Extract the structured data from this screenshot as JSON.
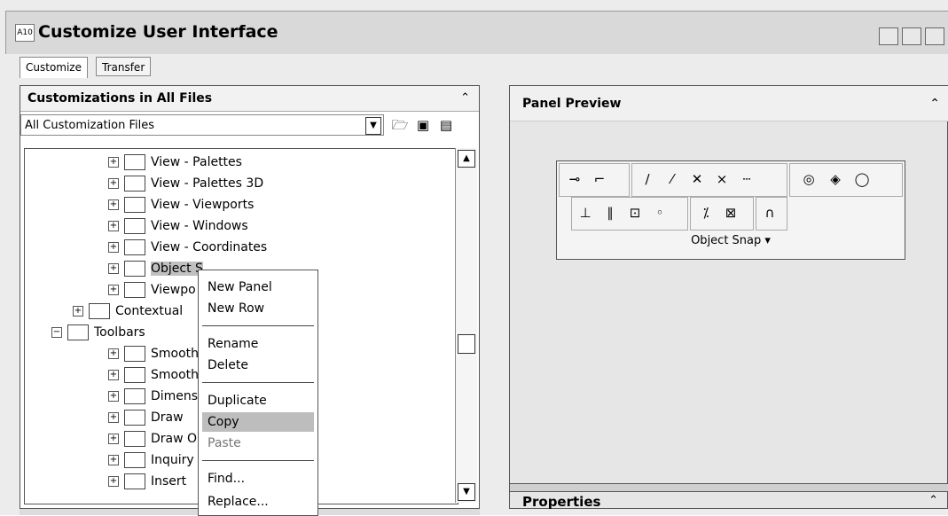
{
  "window": {
    "title": "Customize User Interface",
    "app_icon": "A10"
  },
  "tabs": [
    {
      "label": "Customize"
    },
    {
      "label": "Transfer"
    }
  ],
  "left_panel": {
    "header": "Customizations in All Files",
    "collapse_glyph": "⌃",
    "dropdown_value": "All Customization Files",
    "tree": [
      {
        "label": "View - Palettes"
      },
      {
        "label": "View - Palettes 3D"
      },
      {
        "label": "View - Viewports"
      },
      {
        "label": "View - Windows"
      },
      {
        "label": "View - Coordinates"
      },
      {
        "label": "Object S"
      },
      {
        "label": "Viewpo"
      },
      {
        "label": "Contextual"
      },
      {
        "label": "Toolbars"
      },
      {
        "label": "Smooth Me"
      },
      {
        "label": "Smooth Me"
      },
      {
        "label": "Dimension"
      },
      {
        "label": "Draw"
      },
      {
        "label": "Draw Orde"
      },
      {
        "label": "Inquiry"
      },
      {
        "label": "Insert"
      }
    ]
  },
  "context_menu": {
    "items": [
      {
        "label": "New Panel"
      },
      {
        "label": "New Row"
      },
      {
        "label": "Rename"
      },
      {
        "label": "Delete"
      },
      {
        "label": "Duplicate"
      },
      {
        "label": "Copy"
      },
      {
        "label": "Paste"
      },
      {
        "label": "Find..."
      },
      {
        "label": "Replace..."
      }
    ]
  },
  "right_panel": {
    "header": "Panel Preview",
    "collapse_glyph": "⌃",
    "snap_title": "Object Snap ▾",
    "properties_label": "Properties"
  }
}
